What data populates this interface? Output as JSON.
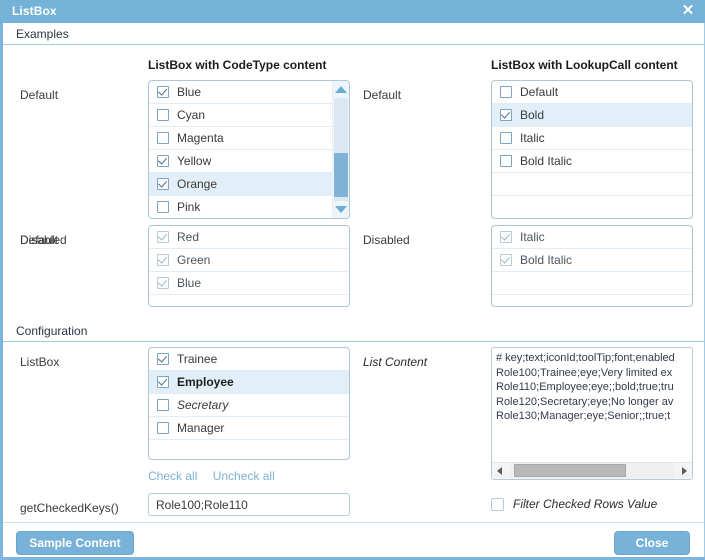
{
  "window": {
    "title": "ListBox",
    "close_icon": "close-icon"
  },
  "sections": {
    "examples": {
      "label": "Examples"
    },
    "configuration": {
      "label": "Configuration"
    }
  },
  "columns": {
    "codetype": "ListBox with CodeType content",
    "lookupcall": "ListBox with LookupCall content"
  },
  "examples": {
    "default_label": "Default",
    "disabled_label": "Disabled",
    "codetype_default": {
      "items": [
        {
          "text": "Blue",
          "checked": true,
          "selected": false
        },
        {
          "text": "Cyan",
          "checked": false,
          "selected": false
        },
        {
          "text": "Magenta",
          "checked": false,
          "selected": false
        },
        {
          "text": "Yellow",
          "checked": true,
          "selected": false
        },
        {
          "text": "Orange",
          "checked": true,
          "selected": true
        },
        {
          "text": "Pink",
          "checked": false,
          "selected": false
        }
      ]
    },
    "codetype_disabled": {
      "items": [
        {
          "text": "Red",
          "checked": true
        },
        {
          "text": "Green",
          "checked": true
        },
        {
          "text": "Blue",
          "checked": true
        }
      ]
    },
    "lookupcall_default": {
      "items": [
        {
          "text": "Default",
          "checked": false,
          "selected": false
        },
        {
          "text": "Bold",
          "checked": true,
          "selected": true
        },
        {
          "text": "Italic",
          "checked": false,
          "selected": false
        },
        {
          "text": "Bold Italic",
          "checked": false,
          "selected": false
        }
      ]
    },
    "lookupcall_disabled": {
      "items": [
        {
          "text": "Italic",
          "checked": true
        },
        {
          "text": "Bold Italic",
          "checked": true
        }
      ]
    }
  },
  "configuration": {
    "listbox_label": "ListBox",
    "listbox_items": [
      {
        "text": "Trainee",
        "checked": true,
        "selected": false,
        "style": "normal"
      },
      {
        "text": "Employee",
        "checked": true,
        "selected": true,
        "style": "bold"
      },
      {
        "text": "Secretary",
        "checked": false,
        "selected": false,
        "style": "italic"
      },
      {
        "text": "Manager",
        "checked": false,
        "selected": false,
        "style": "normal"
      }
    ],
    "check_all_link": "Check all",
    "uncheck_all_link": "Uncheck all",
    "get_checked_keys_label": "getCheckedKeys()",
    "get_checked_keys_value": "Role100;Role110",
    "list_content_label": "List Content",
    "list_content_value": "# key;text;iconId;toolTip;font;enabled\nRole100;Trainee;eye;Very limited ex\nRole110;Employee;eye;;bold;true;tru\nRole120;Secretary;eye;No longer av\nRole130;Manager;eye;Senior;;true;t",
    "filter_checked_rows_label": "Filter Checked Rows Value",
    "filter_checked_rows_checked": false
  },
  "buttons": {
    "sample_content": "Sample Content",
    "close": "Close"
  },
  "colors": {
    "titlebar": "#74b2d8",
    "accent": "#7cb5dd",
    "row_selected": "#e2eff9",
    "link": "#7bb1d7",
    "button": "#78b2d8"
  }
}
